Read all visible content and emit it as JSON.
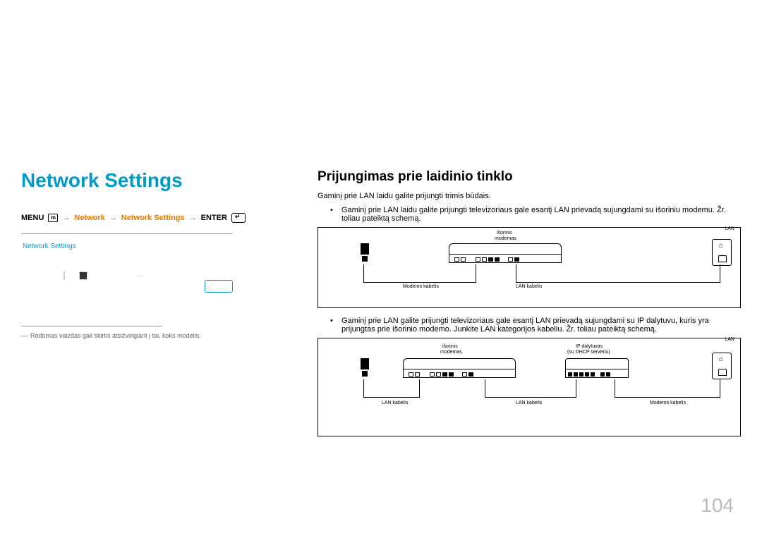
{
  "left": {
    "title": "Network Settings",
    "breadcrumb": {
      "menu": "MENU",
      "m": "m",
      "network": "Network",
      "settings": "Network Settings",
      "enter": "ENTER"
    },
    "menubox_title": "Network Settings",
    "start_btn": "",
    "footnote": "Rodomas vaizdas gali skirtis atsižvelgiant į tai, koks modelis."
  },
  "right": {
    "heading": "Prijungimas prie laidinio tinklo",
    "intro": "Gaminį prie LAN laidu galite prijungti trimis būdais.",
    "bullet1": "Gaminį prie LAN laidu galite prijungti televizoriaus gale esantį LAN prievadą sujungdami su išoriniu modemu. Žr. toliau pateiktą schemą.",
    "bullet2": "Gaminį prie LAN galite prijungti televizoriaus gale esantį LAN prievadą sujungdami su IP dalytuvu, kuris yra prijungtas prie išorinio modemo. Junkite LAN kategorijos kabeliu. Žr. toliau pateiktą schemą.",
    "diagram1": {
      "lan_back": "LAN",
      "modem_label1": "išorinis",
      "modem_label2": "modemas",
      "modem_cable": "Modemo kabelis",
      "lan_cable": "LAN kabelis"
    },
    "diagram2": {
      "lan_back": "LAN",
      "modem_label1": "išorinis",
      "modem_label2": "modemas",
      "router_label1": "IP dalytuvas",
      "router_label2": "(su DHCP serveriu)",
      "modem_cable": "Modemo kabelis",
      "lan_cable": "LAN kabelis"
    }
  },
  "page_number": "104"
}
